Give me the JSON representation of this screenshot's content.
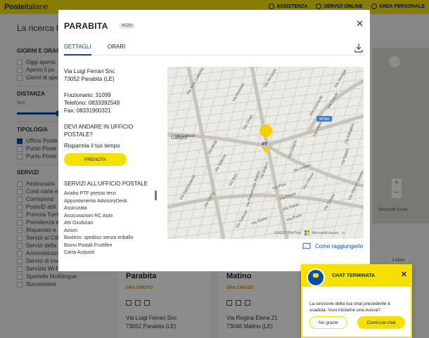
{
  "header": {
    "logo_bold": "Poste",
    "logo_light": "italiane",
    "links": [
      "ASSISTENZA",
      "SERVIZI ONLINE",
      "AREA PERSONALE"
    ]
  },
  "background": {
    "heading": "La ricerca ha",
    "filters": {
      "giorni_h": "GIORNI E ORAR",
      "giorni": [
        "Oggi aperto",
        "Aperto il po",
        "Giorni di ape"
      ],
      "distanza_h": "DISTANZA",
      "distanza_min": "5km",
      "distanza_max": "5k",
      "tipologia_h": "TIPOLOGIA",
      "tipologia": [
        "Ufficio Poste",
        "Punto Poste",
        "Punto Poste"
      ],
      "servizi_h": "SERVIZI",
      "servizi": [
        "Assicurazio",
        "Conti carte e",
        "Corrispond",
        "PostelD abil",
        "Prenota Turn",
        "Previdenza e",
        "Risparmio e",
        "Servizi al Citt",
        "Servizi della Pubblica",
        "Amministrazione - POLIS",
        "Servizi di investimento",
        "Servizio Wi-Fi Free",
        "Sportello Multilingue",
        "Successioni"
      ]
    },
    "map_azure": "Microsoft Azure",
    "km_badge": "3.69km",
    "cards": [
      {
        "name": "Parabita",
        "status": "ORA CHIUSO",
        "addr1": "Via Luigi Ferrari Snc",
        "addr2": "73052 Parabita (LE)"
      },
      {
        "name": "Matino",
        "status": "ORA CHIUSO",
        "addr1": "Via Regina Elena 21",
        "addr2": "73046 Matino (LE)"
      }
    ]
  },
  "modal": {
    "title": "PARABITA",
    "distance": "402M",
    "tabs": [
      "DETTAGLI",
      "ORARI"
    ],
    "address_line1": "Via Luigi Ferrari Snc",
    "address_line2": "73052 Parabita (LE)",
    "frazionario": "Frazionario: 31099",
    "telefono": "Telefono: 0833392549",
    "fax": "Fax: 08331900321",
    "question": "DEVI ANDARE IN UFFICIO POSTALE?",
    "hint": "Risparmia il tuo tempo",
    "prenota": "PRENOTA",
    "services_heading": "SERVIZI ALL'UFFICIO POSTALE",
    "services": [
      "Analisi PTF presso terzi",
      "Appuntamento AdvisoryDesk",
      "Assicurata",
      "Assicurazioni RC Auto",
      "Atti Giudiziari",
      "Azioni",
      "Boxless: spedisci senza imballo",
      "Buoni Postali Fruttiferi",
      "Carta Acquisti"
    ],
    "map": {
      "marker": "PT",
      "gallipoli_label": "Gallipol",
      "road_badge": "SP361",
      "attribution": "©2023 TomTom",
      "azure": "Microsoft Azure",
      "streets": [
        "Via Suor Caterina Candido",
        "Via Pescara",
        "Via Chieti",
        "Via Gallipoli",
        "Via Ortana",
        "Via Salerno",
        "Via Bari",
        "Via Pisa",
        "Via Fiume",
        "Via Carso",
        "Via Piave",
        "Via Trieste",
        "Via Sauro",
        "Via Vittorio",
        "Via Matino",
        "Via Provinciale Matino",
        "Via Como",
        "Via Sant'Antonio",
        "Via Impero",
        "Via Torino",
        "Via Adriatico",
        "Via Tirreno",
        "Via Galvani",
        "Via Saragat",
        "Via Vittorio Veneto",
        "Via Cavour",
        "Via Verdi",
        "Via Torrazzo",
        "Via Leonardo"
      ]
    },
    "route_link": "Come raggiungerlo"
  },
  "chat": {
    "title": "CHAT TERMINATA",
    "message": "La sessione della tua chat precedente è scaduta. Vuoi iniziarne una nuova?",
    "no_label": "No grazie",
    "yes_label": "Comincia chat"
  }
}
